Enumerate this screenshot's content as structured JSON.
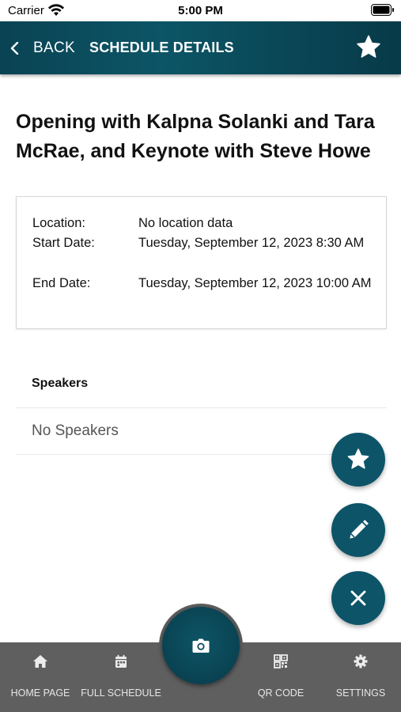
{
  "status_bar": {
    "carrier": "Carrier",
    "time": "5:00 PM"
  },
  "header": {
    "back_label": "BACK",
    "title": "SCHEDULE DETAILS"
  },
  "session": {
    "title": "Opening with Kalpna Solanki and Tara McRae, and Keynote with Steve Howe"
  },
  "details": {
    "location_label": "Location:",
    "location_value": "No location data",
    "start_label": "Start Date:",
    "start_value": "Tuesday, September 12, 2023 8:30 AM",
    "end_label": "End Date:",
    "end_value": "Tuesday, September 12, 2023 10:00 AM"
  },
  "speakers": {
    "heading": "Speakers",
    "empty_text": "No Speakers"
  },
  "fabs": {
    "favorite_icon": "star-icon",
    "edit_icon": "pencil-icon",
    "close_icon": "close-icon"
  },
  "tabs": [
    {
      "label": "HOME PAGE",
      "icon": "home-icon"
    },
    {
      "label": "FULL SCHEDULE",
      "icon": "calendar-icon"
    },
    {
      "label": "QR CODE",
      "icon": "qr-code-icon"
    },
    {
      "label": "SETTINGS",
      "icon": "gear-icon"
    }
  ],
  "center_action": {
    "icon": "camera-icon"
  },
  "colors": {
    "header": "#0c5566",
    "fab": "#0d5468",
    "tab_bar": "#5f5f5f"
  }
}
